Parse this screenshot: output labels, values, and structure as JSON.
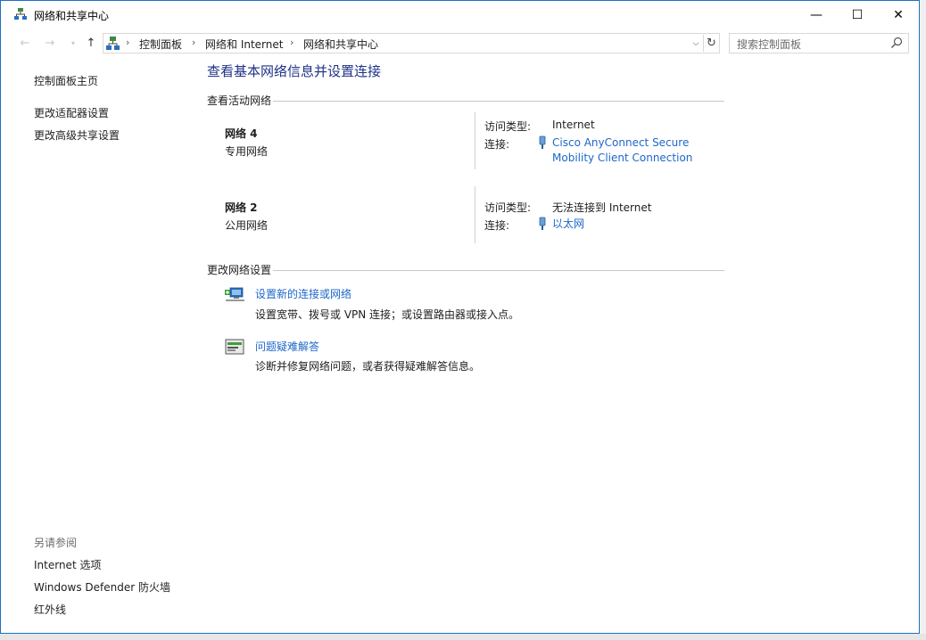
{
  "window": {
    "title": "网络和共享中心",
    "controls": {
      "minimize": "—",
      "maximize": "☐",
      "close": "✕"
    }
  },
  "nav": {
    "back": "←",
    "forward": "→",
    "recent": "▾",
    "up": "↑",
    "breadcrumbs": [
      "控制面板",
      "网络和 Internet",
      "网络和共享中心"
    ],
    "separator": "›",
    "dropdown": "⌵",
    "refresh": "↻",
    "search_placeholder": "搜索控制面板"
  },
  "sidebar": {
    "links": [
      "控制面板主页",
      "更改适配器设置",
      "更改高级共享设置"
    ],
    "see_also_heading": "另请参阅",
    "see_also": [
      "Internet 选项",
      "Windows Defender 防火墙",
      "红外线"
    ]
  },
  "main": {
    "title": "查看基本网络信息并设置连接",
    "active_networks_heading": "查看活动网络",
    "networks": [
      {
        "name": "网络 4",
        "type": "专用网络",
        "access_label": "访问类型:",
        "access_value": "Internet",
        "connection_label": "连接:",
        "connection_lines": [
          "Cisco AnyConnect Secure",
          "Mobility Client Connection"
        ]
      },
      {
        "name": "网络 2",
        "type": "公用网络",
        "access_label": "访问类型:",
        "access_value": "无法连接到 Internet",
        "connection_label": "连接:",
        "connection_lines": [
          "以太网"
        ]
      }
    ],
    "change_settings_heading": "更改网络设置",
    "tasks": [
      {
        "link": "设置新的连接或网络",
        "desc": "设置宽带、拨号或 VPN 连接；或设置路由器或接入点。"
      },
      {
        "link": "问题疑难解答",
        "desc": "诊断并修复网络问题，或者获得疑难解答信息。"
      }
    ]
  },
  "colors": {
    "link": "#1e67c8",
    "title": "#1e3287",
    "window_border": "#1e6fc8"
  }
}
